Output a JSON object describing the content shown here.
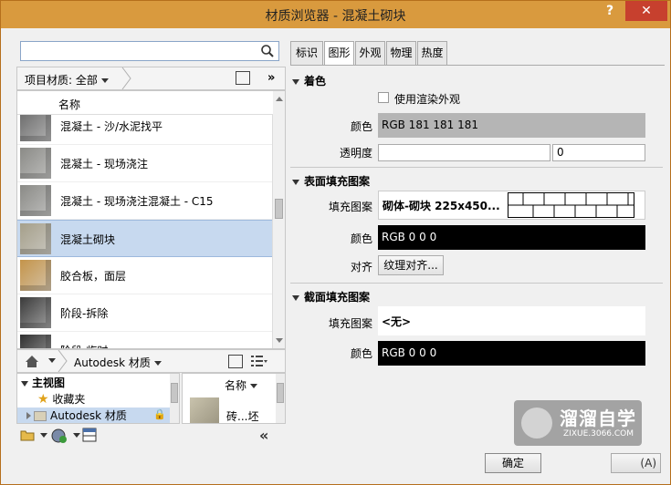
{
  "window": {
    "title": "材质浏览器 - 混凝土砌块",
    "help": "?",
    "close": "✕"
  },
  "search": {
    "placeholder": "",
    "value": ""
  },
  "library_bar": {
    "label": "项目材质: 全部",
    "more": "»"
  },
  "material_list": {
    "header": "名称",
    "rows": [
      {
        "label": "混凝土 - 沙/水泥找平",
        "color": "#6a6a6a",
        "selected": false
      },
      {
        "label": "混凝土 - 现场浇注",
        "color": "#8a8a86",
        "selected": false
      },
      {
        "label": "混凝土 - 现场浇注混凝土 - C15",
        "color": "#8a8a86",
        "selected": false
      },
      {
        "label": "混凝土砌块",
        "color": "#a59f8a",
        "selected": true
      },
      {
        "label": "胶合板，面层",
        "color": "#c4944a",
        "selected": false
      },
      {
        "label": "阶段-拆除",
        "color": "#3a3a3a",
        "selected": false
      },
      {
        "label": "阶段-临时",
        "color": "#2f2f2f",
        "selected": false
      }
    ]
  },
  "library2_bar": {
    "label": "Autodesk 材质"
  },
  "tree": {
    "items": [
      {
        "label": "主视图",
        "bold": true
      },
      {
        "label": "收藏夹"
      },
      {
        "label": "Autodesk 材质",
        "selected": true
      }
    ]
  },
  "thumbs2": {
    "header": "名称",
    "item": "砖...坯"
  },
  "tabs": [
    "标识",
    "图形",
    "外观",
    "物理",
    "热度"
  ],
  "active_tab": "图形",
  "shading": {
    "title": "着色",
    "use_render_label": "使用渲染外观",
    "color_label": "颜色",
    "color_value": "RGB 181 181 181",
    "color_hex": "#b5b5b5",
    "transparency_label": "透明度",
    "transparency_value": "0"
  },
  "surface_pattern": {
    "title": "表面填充图案",
    "pattern_label": "填充图案",
    "pattern_value": "砌体-砌块 225x450...",
    "color_label": "颜色",
    "color_value": "RGB 0 0 0",
    "color_hex": "#000000",
    "align_label": "对齐",
    "align_button": "纹理对齐..."
  },
  "cut_pattern": {
    "title": "截面填充图案",
    "pattern_label": "填充图案",
    "pattern_value": "<无>",
    "color_label": "颜色",
    "color_value": "RGB 0 0 0",
    "color_hex": "#000000"
  },
  "footer": {
    "ok": "确定",
    "apply": "(A)"
  },
  "watermark": {
    "text": "溜溜自学",
    "sub": "ZIXUE.3066.COM"
  }
}
